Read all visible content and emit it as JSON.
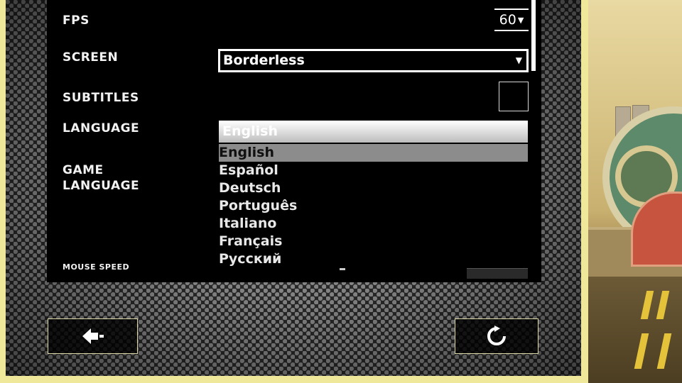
{
  "settings": {
    "fps": {
      "label": "FPS",
      "value": "60"
    },
    "screen": {
      "label": "SCREEN",
      "value": "Borderless"
    },
    "subtitles": {
      "label": "SUBTITLES",
      "checked": false
    },
    "language": {
      "label": "LANGUAGE",
      "value": "English",
      "options": [
        "English",
        "Español",
        "Deutsch",
        "Português",
        "Italiano",
        "Français",
        "Русский"
      ],
      "selected_index": 0
    },
    "game_language": {
      "label_line1": "GAME",
      "label_line2": "LANGUAGE"
    },
    "mouse_speed": {
      "label": "MOUSE SPEED"
    }
  },
  "footer": {
    "back_icon": "back-arrow-icon",
    "reset_icon": "reset-icon"
  },
  "colors": {
    "frame_border": "#efe79a",
    "panel": "#000000",
    "dropdown_highlight": "#8c8c8c"
  }
}
